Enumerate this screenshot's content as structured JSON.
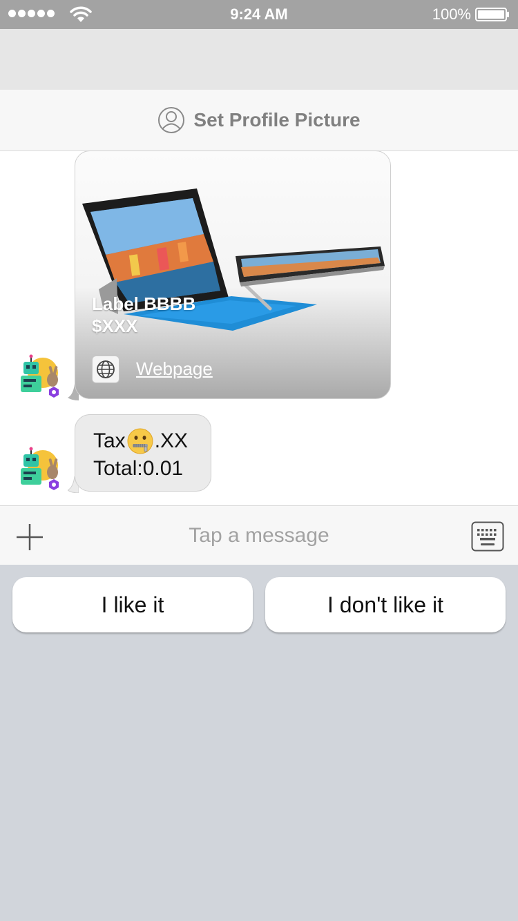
{
  "status_bar": {
    "time": "9:24 AM",
    "battery_percent": "100%"
  },
  "profile_bar": {
    "label": "Set Profile Picture"
  },
  "messages": [
    {
      "type": "card",
      "title": "Label BBBB",
      "price": "$XXX",
      "link_label": "Webpage",
      "link_icon": "globe-icon"
    },
    {
      "type": "text",
      "line1_before": "Tax",
      "line1_emoji": "zipper-mouth-face",
      "line1_after": ".XX",
      "line2": "Total:0.01"
    }
  ],
  "input_bar": {
    "placeholder": "Tap a message"
  },
  "quick_replies": [
    {
      "label": "I like it"
    },
    {
      "label": "I don't like it"
    }
  ],
  "colors": {
    "status_bar": "#a3a3a3",
    "reply_area": "#d1d5db",
    "bubble": "#ebebeb"
  }
}
